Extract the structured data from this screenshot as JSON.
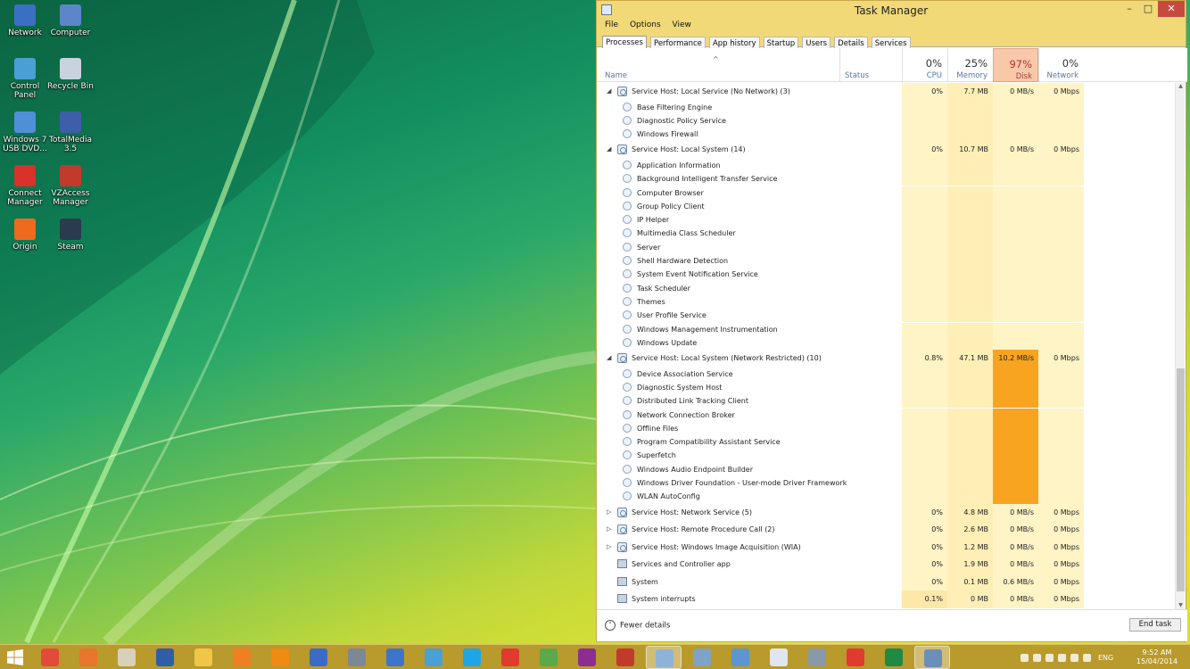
{
  "desktop": {
    "icons": [
      {
        "label": "Network",
        "icon": "network-icon",
        "color": "#3b6fc4"
      },
      {
        "label": "Computer",
        "icon": "computer-icon",
        "color": "#5d86c9"
      },
      {
        "label": "Control Panel",
        "icon": "control-panel-icon",
        "color": "#4a9fd5"
      },
      {
        "label": "Recycle Bin",
        "icon": "recycle-bin-icon",
        "color": "#c9d3de"
      },
      {
        "label": "Windows 7 USB DVD...",
        "icon": "usb-dvd-tool-icon",
        "color": "#4f8fd8"
      },
      {
        "label": "TotalMedia 3.5",
        "icon": "totalmedia-icon",
        "color": "#3c5fa8"
      },
      {
        "label": "Connect Manager",
        "icon": "connect-manager-icon",
        "color": "#d8322b"
      },
      {
        "label": "VZAccess Manager",
        "icon": "vzaccess-icon",
        "color": "#c23a2c"
      },
      {
        "label": "Origin",
        "icon": "origin-icon",
        "color": "#ee6a1e"
      },
      {
        "label": "Steam",
        "icon": "steam-icon",
        "color": "#2a3a4f"
      }
    ]
  },
  "taskmanager": {
    "title": "Task Manager",
    "window_buttons": {
      "minimize": "–",
      "maximize": "□",
      "close": "✕"
    },
    "menu": [
      "File",
      "Options",
      "View"
    ],
    "tabs": [
      "Processes",
      "Performance",
      "App history",
      "Startup",
      "Users",
      "Details",
      "Services"
    ],
    "active_tab": "Processes",
    "header": {
      "sort_indicator": "^",
      "name": "Name",
      "status": "Status",
      "cpu": {
        "pct": "0%",
        "label": "CPU"
      },
      "memory": {
        "pct": "25%",
        "label": "Memory"
      },
      "disk": {
        "pct": "97%",
        "label": "Disk"
      },
      "network": {
        "pct": "0%",
        "label": "Network"
      }
    },
    "rows": [
      {
        "type": "parent",
        "expander": "◢",
        "name": "Service Host: Local Service (No Network) (3)",
        "cpu": "0%",
        "mem": "7.7 MB",
        "disk": "0 MB/s",
        "net": "0 Mbps"
      },
      {
        "type": "child",
        "name": "Base Filtering Engine"
      },
      {
        "type": "child",
        "name": "Diagnostic Policy Service"
      },
      {
        "type": "child",
        "name": "Windows Firewall"
      },
      {
        "type": "parent",
        "expander": "◢",
        "name": "Service Host: Local System (14)",
        "cpu": "0%",
        "mem": "10.7 MB",
        "disk": "0 MB/s",
        "net": "0 Mbps"
      },
      {
        "type": "child",
        "name": "Application Information"
      },
      {
        "type": "child",
        "name": "Background Intelligent Transfer Service"
      },
      {
        "type": "child",
        "name": "Computer Browser"
      },
      {
        "type": "child",
        "name": "Group Policy Client"
      },
      {
        "type": "child",
        "name": "IP Helper"
      },
      {
        "type": "child",
        "name": "Multimedia Class Scheduler"
      },
      {
        "type": "child",
        "name": "Server"
      },
      {
        "type": "child",
        "name": "Shell Hardware Detection"
      },
      {
        "type": "child",
        "name": "System Event Notification Service"
      },
      {
        "type": "child",
        "name": "Task Scheduler"
      },
      {
        "type": "child",
        "name": "Themes"
      },
      {
        "type": "child",
        "name": "User Profile Service"
      },
      {
        "type": "child",
        "name": "Windows Management Instrumentation"
      },
      {
        "type": "child",
        "name": "Windows Update"
      },
      {
        "type": "parent",
        "expander": "◢",
        "name": "Service Host: Local System (Network Restricted) (10)",
        "cpu": "0.8%",
        "mem": "47.1 MB",
        "disk": "10.2 MB/s",
        "net": "0 Mbps",
        "hot": true
      },
      {
        "type": "child",
        "name": "Device Association Service",
        "hot": true
      },
      {
        "type": "child",
        "name": "Diagnostic System Host",
        "hot": true
      },
      {
        "type": "child",
        "name": "Distributed Link Tracking Client",
        "hot": true
      },
      {
        "type": "child",
        "name": "Network Connection Broker",
        "hot": true
      },
      {
        "type": "child",
        "name": "Offline Files",
        "hot": true
      },
      {
        "type": "child",
        "name": "Program Compatibility Assistant Service",
        "hot": true
      },
      {
        "type": "child",
        "name": "Superfetch",
        "hot": true
      },
      {
        "type": "child",
        "name": "Windows Audio Endpoint Builder",
        "hot": true
      },
      {
        "type": "child",
        "name": "Windows Driver Foundation - User-mode Driver Framework",
        "hot": true
      },
      {
        "type": "child",
        "name": "WLAN AutoConfig",
        "hot": true
      },
      {
        "type": "parent",
        "expander": "▷",
        "name": "Service Host: Network Service (5)",
        "cpu": "0%",
        "mem": "4.8 MB",
        "disk": "0 MB/s",
        "net": "0 Mbps"
      },
      {
        "type": "parent",
        "expander": "▷",
        "name": "Service Host: Remote Procedure Call (2)",
        "cpu": "0%",
        "mem": "2.6 MB",
        "disk": "0 MB/s",
        "net": "0 Mbps"
      },
      {
        "type": "parent",
        "expander": "▷",
        "name": "Service Host: Windows Image Acquisition (WIA)",
        "cpu": "0%",
        "mem": "1.2 MB",
        "disk": "0 MB/s",
        "net": "0 Mbps"
      },
      {
        "type": "app",
        "name": "Services and Controller app",
        "cpu": "0%",
        "mem": "1.9 MB",
        "disk": "0 MB/s",
        "net": "0 Mbps"
      },
      {
        "type": "app",
        "name": "System",
        "cpu": "0%",
        "mem": "0.1 MB",
        "disk": "0.6 MB/s",
        "net": "0 Mbps"
      },
      {
        "type": "app",
        "name": "System interrupts",
        "cpu": "0.1%",
        "mem": "0 MB",
        "disk": "0 MB/s",
        "net": "0 Mbps",
        "warm_cpu": true
      }
    ],
    "footer": {
      "fewer_details": "Fewer details",
      "end_task": "End task"
    }
  },
  "taskbar": {
    "start": "windows-start-icon",
    "apps": [
      {
        "icon": "chrome-icon",
        "color": "#e34a3b"
      },
      {
        "icon": "firefox-icon",
        "color": "#e8762d"
      },
      {
        "icon": "garlic-app-icon",
        "color": "#d8d0b8"
      },
      {
        "icon": "globe-app-icon",
        "color": "#2f5ea8"
      },
      {
        "icon": "file-explorer-icon",
        "color": "#f0c64a"
      },
      {
        "icon": "media-player-icon",
        "color": "#f07f24"
      },
      {
        "icon": "vlc-icon",
        "color": "#f08a12"
      },
      {
        "icon": "google-earth-icon",
        "color": "#3a6bc7"
      },
      {
        "icon": "film-app-icon",
        "color": "#7d8897"
      },
      {
        "icon": "app-blue-icon",
        "color": "#3d76c8"
      },
      {
        "icon": "control-panel-icon",
        "color": "#4a9fd5"
      },
      {
        "icon": "skype-icon",
        "color": "#1ea5e6"
      },
      {
        "icon": "popcorn-icon",
        "color": "#e23a2e"
      },
      {
        "icon": "utorrent-icon",
        "color": "#5aa94b"
      },
      {
        "icon": "winrar-icon",
        "color": "#8a2f8f"
      },
      {
        "icon": "vzaccess-icon",
        "color": "#c23a2c"
      },
      {
        "icon": "task-manager-icon",
        "color": "#8fb2d8",
        "active": true
      },
      {
        "icon": "notes-app-icon",
        "color": "#7ea3c7"
      },
      {
        "icon": "photo-viewer-icon",
        "color": "#5d95d0"
      },
      {
        "icon": "paint-icon",
        "color": "#dfe6ee"
      },
      {
        "icon": "calculator-icon",
        "color": "#8899aa"
      },
      {
        "icon": "power-app-icon",
        "color": "#e03b2e"
      },
      {
        "icon": "excel-icon",
        "color": "#1f8a44"
      },
      {
        "icon": "settings-gear-icon",
        "color": "#6b8fb8",
        "active": true
      }
    ],
    "tray": {
      "language": "ENG",
      "time": "9:52 AM",
      "date": "15/04/2014"
    }
  }
}
